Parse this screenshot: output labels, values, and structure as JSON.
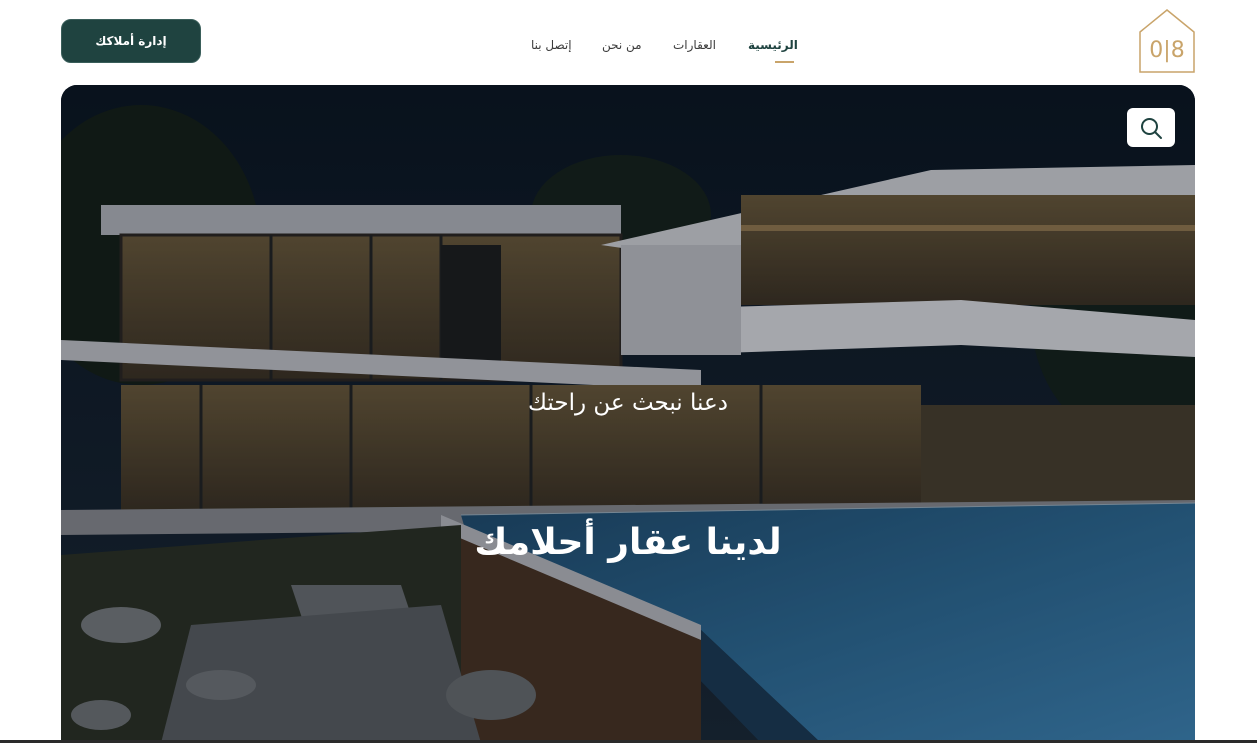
{
  "header": {
    "nav": [
      {
        "label": "الرئيسية",
        "active": true
      },
      {
        "label": "العقارات",
        "active": false
      },
      {
        "label": "من نحن",
        "active": false
      },
      {
        "label": "إتصل بنا",
        "active": false
      }
    ],
    "cta_label": "إدارة أملاكك",
    "logo_text": "8|0"
  },
  "hero": {
    "subtitle": "دعنا نبحث عن راحتك",
    "title": "لدينا عقار أحلامك",
    "search_icon": "search-icon"
  },
  "colors": {
    "brand_dark": "#1f4340",
    "accent_gold": "#c9a46a"
  }
}
